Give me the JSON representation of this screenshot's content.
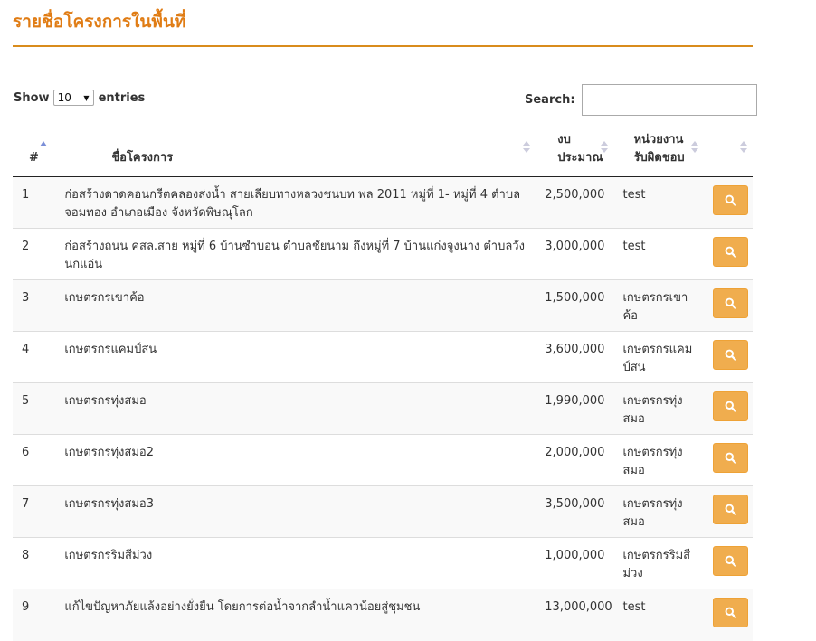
{
  "page": {
    "title": "รายชื่อโครงการในพื้นที่"
  },
  "length_control": {
    "prefix": "Show",
    "selected": "10",
    "suffix": "entries"
  },
  "search": {
    "label": "Search:",
    "value": ""
  },
  "table": {
    "headers": {
      "num": "#",
      "name": "ชื่อโครงการ",
      "budget": "งบประมาณ",
      "dept": "หน่วยงานรับผิดชอบ",
      "action": ""
    },
    "sorted_column": "num",
    "rows": [
      {
        "num": "1",
        "name": "ก่อสร้างดาดคอนกรีตคลองส่งน้ำ สายเลียบทางหลวงชนบท พล 2011 หมู่ที่ 1- หมู่ที่ 4 ตำบลจอมทอง อำเภอเมือง จังหวัดพิษณุโลก",
        "budget": "2,500,000",
        "dept": "test"
      },
      {
        "num": "2",
        "name": "ก่อสร้างถนน คสล.สาย หมู่ที่ 6 บ้านซำบอน ตำบลชัยนาม ถึงหมู่ที่ 7 บ้านแก่งจูงนาง ตำบลวังนกแอ่น",
        "budget": "3,000,000",
        "dept": "test"
      },
      {
        "num": "3",
        "name": "เกษตรกรเขาค้อ",
        "budget": "1,500,000",
        "dept": "เกษตรกรเขาค้อ"
      },
      {
        "num": "4",
        "name": "เกษตรกรแคมป์สน",
        "budget": "3,600,000",
        "dept": "เกษตรกรแคมป์สน"
      },
      {
        "num": "5",
        "name": "เกษตรกรทุ่งสมอ",
        "budget": "1,990,000",
        "dept": "เกษตรกรทุ่งสมอ"
      },
      {
        "num": "6",
        "name": "เกษตรกรทุ่งสมอ2",
        "budget": "2,000,000",
        "dept": "เกษตรกรทุ่งสมอ"
      },
      {
        "num": "7",
        "name": "เกษตรกรทุ่งสมอ3",
        "budget": "3,500,000",
        "dept": "เกษตรกรทุ่งสมอ"
      },
      {
        "num": "8",
        "name": "เกษตรกรริมสีม่วง",
        "budget": "1,000,000",
        "dept": "เกษตรกรริมสีม่วง"
      },
      {
        "num": "9",
        "name": "แก้ไขปัญหาภัยแล้งอย่างยั่งยืน โดยการต่อน้ำจากลำน้ำแควน้อยสู่ชุมชน",
        "budget": "13,000,000",
        "dept": "test"
      }
    ]
  },
  "colors": {
    "accent": "#e07c14",
    "button": "#f0ad4e",
    "sort_active": "#7b8fd8"
  },
  "icons": {
    "row_action": "search-icon"
  }
}
